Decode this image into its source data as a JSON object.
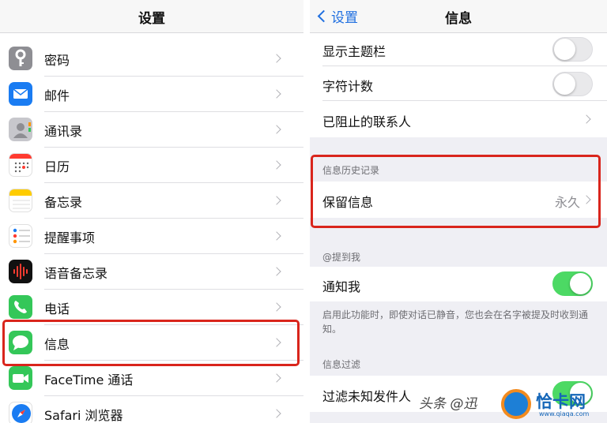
{
  "left": {
    "title": "设置",
    "items": [
      {
        "label": "密码",
        "icon": "key-icon",
        "color": "#8e8e93"
      },
      {
        "label": "邮件",
        "icon": "mail-icon",
        "color": "#1a7cf2"
      },
      {
        "label": "通讯录",
        "icon": "contacts-icon",
        "color": "#9a9a9f"
      },
      {
        "label": "日历",
        "icon": "calendar-icon",
        "color": "#ffffff"
      },
      {
        "label": "备忘录",
        "icon": "notes-icon",
        "color": "#ffcc00"
      },
      {
        "label": "提醒事项",
        "icon": "reminders-icon",
        "color": "#ffffff"
      },
      {
        "label": "语音备忘录",
        "icon": "voice-memos-icon",
        "color": "#111111"
      },
      {
        "label": "电话",
        "icon": "phone-icon",
        "color": "#34c759"
      },
      {
        "label": "信息",
        "icon": "messages-icon",
        "color": "#34c759"
      },
      {
        "label": "FaceTime 通话",
        "icon": "facetime-icon",
        "color": "#34c759"
      },
      {
        "label": "Safari 浏览器",
        "icon": "safari-icon",
        "color": "#1a7cf2"
      }
    ]
  },
  "right": {
    "back_label": "设置",
    "title": "信息",
    "rows_top": [
      {
        "label": "显示主题栏",
        "toggle": false
      },
      {
        "label": "字符计数",
        "toggle": false
      },
      {
        "label": "已阻止的联系人"
      }
    ],
    "history_header": "信息历史记录",
    "keep_label": "保留信息",
    "keep_value": "永久",
    "mention_header": "@提到我",
    "notify_label": "通知我",
    "notify_on": true,
    "notify_footer": "启用此功能时，即使对话已静音，您也会在名字被提及时收到通知。",
    "filter_header": "信息过滤",
    "filter_label": "过滤未知发件人"
  },
  "watermark": {
    "text": "头条 @迅",
    "logo_text": "恰卡网",
    "logo_sub": "www.qiaqa.com"
  },
  "colors": {
    "highlight": "#d9251c",
    "accent": "#1f6fe0",
    "toggle_on": "#4cd964"
  }
}
